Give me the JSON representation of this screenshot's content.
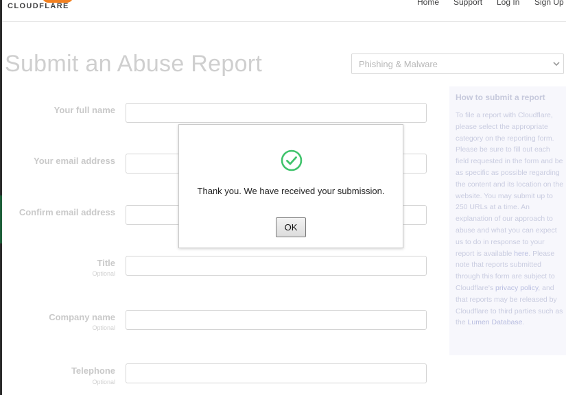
{
  "header": {
    "logo_text": "CLOUDFLARE",
    "nav": [
      "Home",
      "Support",
      "Log In",
      "Sign Up"
    ]
  },
  "page": {
    "title": "Submit an Abuse Report",
    "category_select": {
      "value": "Phishing & Malware"
    }
  },
  "form": {
    "fields": [
      {
        "label": "Your full name",
        "optional": ""
      },
      {
        "label": "Your email address",
        "optional": ""
      },
      {
        "label": "Confirm email address",
        "optional": ""
      },
      {
        "label": "Title",
        "optional": "Optional"
      },
      {
        "label": "Company name",
        "optional": "Optional"
      },
      {
        "label": "Telephone",
        "optional": "Optional"
      }
    ]
  },
  "sidebar": {
    "title": "How to submit a report",
    "body_1": "To file a report with Cloudflare, please select the appropriate category on the reporting form. Please be sure to fill out each field requested in the form and be as specific as possible regarding the content and its location on the website. You may submit up to 250 URLs at a time. An explanation of our approach to abuse and what you can expect us to do in response to your report is available ",
    "link_here": "here",
    "body_2": ". Please note that reports submitted through this form are subject to Cloudflare's ",
    "link_privacy": "privacy policy",
    "body_3": ", and that reports may be released by Cloudflare to third parties such as the ",
    "link_lumen": "Lumen Database",
    "body_4": "."
  },
  "modal": {
    "icon": "check-circle-icon",
    "message": "Thank you. We have received your submission.",
    "ok_label": "OK"
  },
  "colors": {
    "brand_orange": "#f38020",
    "success_green": "#3fc36b"
  }
}
